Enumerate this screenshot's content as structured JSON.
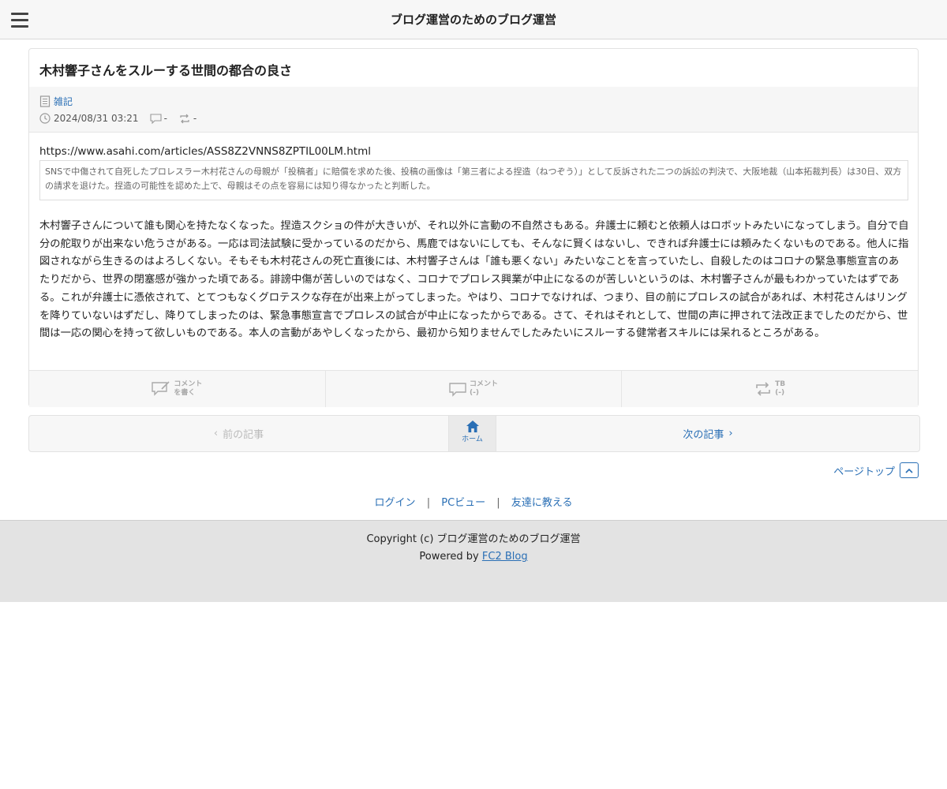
{
  "header": {
    "site_title": "ブログ運営のためのブログ運営",
    "menu_icon": "hamburger-icon"
  },
  "article": {
    "title": "木村響子さんをスルーする世間の都合の良さ",
    "category": "雑記",
    "datetime": "2024/08/31 03:21",
    "comment_count": "-",
    "trackback_count": "-",
    "url": "https://www.asahi.com/articles/ASS8Z2VNNS8ZPTIL00LM.html",
    "quote": "SNSで中傷されて自死したプロレスラー木村花さんの母親が「投稿者」に賠償を求めた後、投稿の画像は「第三者による捏造（ねつぞう）」として反訴された二つの訴訟の判決で、大阪地裁（山本拓裁判長）は30日、双方の請求を退けた。捏造の可能性を認めた上で、母親はその点を容易には知り得なかったと判断した。",
    "body": "木村響子さんについて誰も関心を持たなくなった。捏造スクショの件が大きいが、それ以外に言動の不自然さもある。弁護士に頼むと依頼人はロボットみたいになってしまう。自分で自分の舵取りが出来ない危うさがある。一応は司法試験に受かっているのだから、馬鹿ではないにしても、そんなに賢くはないし、できれば弁護士には頼みたくないものである。他人に指図されながら生きるのはよろしくない。そもそも木村花さんの死亡直後には、木村響子さんは「誰も悪くない」みたいなことを言っていたし、自殺したのはコロナの緊急事態宣言のあたりだから、世界の閉塞感が強かった頃である。誹謗中傷が苦しいのではなく、コロナでプロレス興業が中止になるのが苦しいというのは、木村響子さんが最もわかっていたはずである。これが弁護士に憑依されて、とてつもなくグロテスクな存在が出来上がってしまった。やはり、コロナでなければ、つまり、目の前にプロレスの試合があれば、木村花さんはリングを降りていないはずだし、降りてしまったのは、緊急事態宣言でプロレスの試合が中止になったからである。さて、それはそれとして、世間の声に押されて法改正までしたのだから、世間は一応の関心を持って欲しいものである。本人の言動があやしくなったから、最初から知りませんでしたみたいにスルーする健常者スキルには呆れるところがある。",
    "actions": {
      "write_comment": [
        "コメント",
        "を書く"
      ],
      "comments": [
        "コメント",
        "(-)"
      ],
      "trackback": [
        "TB",
        "(-)"
      ]
    }
  },
  "pager": {
    "prev": "前の記事",
    "home": "ホーム",
    "next": "次の記事"
  },
  "page_top": "ページトップ",
  "links": {
    "login": "ログイン",
    "pc_view": "PCビュー",
    "tell_friend": "友達に教える",
    "separator": "|"
  },
  "footer": {
    "copyright": "Copyright (c) ブログ運営のためのブログ運営",
    "powered_by": "Powered by",
    "powered_link": "FC2 Blog"
  },
  "colors": {
    "link": "#2a6fb5",
    "topbar_bg": "#f7f7f7",
    "footer_bg": "#e3e3e3"
  }
}
